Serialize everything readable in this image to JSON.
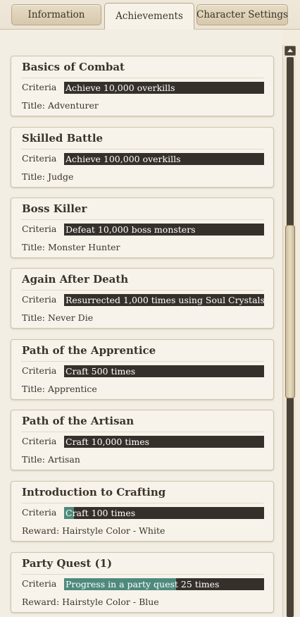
{
  "tabs": [
    {
      "label": "Information",
      "active": false
    },
    {
      "label": "Achievements",
      "active": true
    },
    {
      "label": "Character Settings",
      "active": false
    }
  ],
  "criteria_label": "Criteria",
  "achievements": [
    {
      "title": "Basics of Combat",
      "criteria": "Achieve 10,000 overkills",
      "progress": 0,
      "reward": "Title: Adventurer"
    },
    {
      "title": "Skilled Battle",
      "criteria": "Achieve 100,000 overkills",
      "progress": 0,
      "reward": "Title: Judge"
    },
    {
      "title": "Boss Killer",
      "criteria": "Defeat 10,000 boss monsters",
      "progress": 0,
      "reward": "Title: Monster Hunter"
    },
    {
      "title": "Again After Death",
      "criteria": "Resurrected 1,000 times using Soul Crystals",
      "progress": 0,
      "reward": "Title: Never Die"
    },
    {
      "title": "Path of the Apprentice",
      "criteria": "Craft 500 times",
      "progress": 0,
      "reward": "Title: Apprentice"
    },
    {
      "title": "Path of the Artisan",
      "criteria": "Craft 10,000 times",
      "progress": 0,
      "reward": "Title: Artisan"
    },
    {
      "title": "Introduction to Crafting",
      "criteria": "Craft 100 times",
      "progress": 0.05,
      "reward": "Reward: Hairstyle Color - White"
    },
    {
      "title": "Party Quest (1)",
      "criteria": "Progress in a party quest 25 times",
      "progress": 0.56,
      "reward": "Reward: Hairstyle Color - Blue"
    }
  ],
  "colors": {
    "progress_bar": "#35302a",
    "progress_fill": "#4e8a7c",
    "card_bg": "#f7f3ea"
  }
}
